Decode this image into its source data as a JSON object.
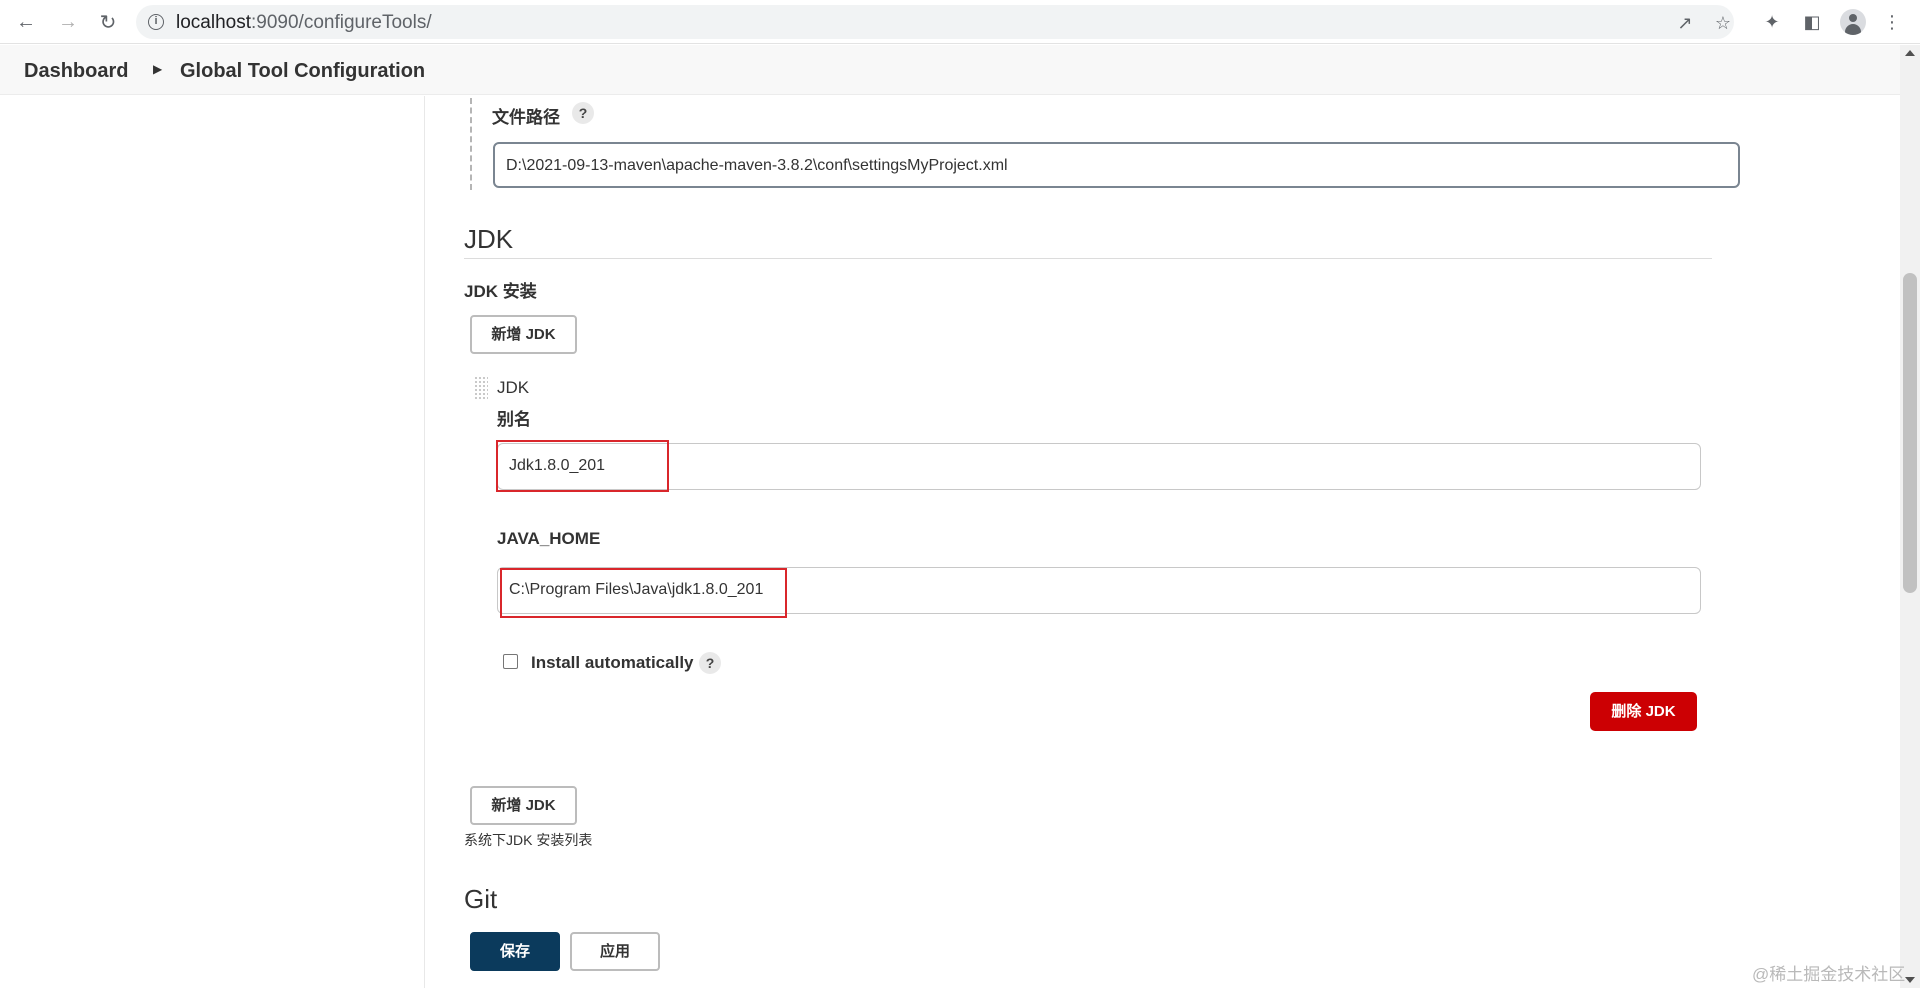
{
  "browser": {
    "url_host": "localhost",
    "url_path": ":9090/configureTools/"
  },
  "breadcrumb": {
    "items": [
      "Dashboard",
      "Global Tool Configuration"
    ]
  },
  "maven_settings": {
    "file_path_label": "文件路径",
    "file_path_value": "D:\\2021-09-13-maven\\apache-maven-3.8.2\\conf\\settingsMyProject.xml"
  },
  "jdk": {
    "section_title": "JDK",
    "installations_label": "JDK 安装",
    "add_button_label": "新增 JDK",
    "item_header": "JDK",
    "alias_label": "别名",
    "alias_value": "Jdk1.8.0_201",
    "java_home_label": "JAVA_HOME",
    "java_home_value": "C:\\Program Files\\Java\\jdk1.8.0_201",
    "install_automatically_label": "Install automatically",
    "install_automatically_checked": false,
    "delete_button_label": "删除 JDK",
    "add_button_bottom_label": "新增 JDK",
    "list_description": "系统下JDK 安装列表"
  },
  "git": {
    "section_title": "Git"
  },
  "footer": {
    "save_label": "保存",
    "apply_label": "应用"
  },
  "watermark": "@稀土掘金技术社区",
  "help_glyph": "?",
  "colors": {
    "highlight": "#d9262b",
    "primary": "#0b3a5c",
    "danger": "#cc0003"
  }
}
